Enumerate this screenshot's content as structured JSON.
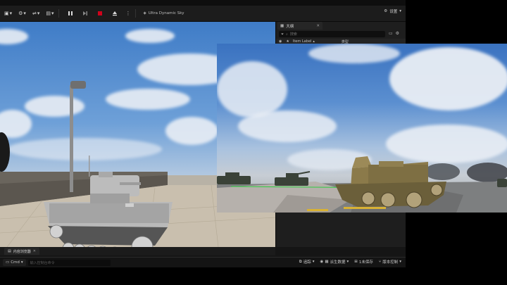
{
  "toolbar": {
    "play_label": "",
    "level_name": "Ultra Dynamic Sky",
    "settings_label": "设置"
  },
  "outliner": {
    "tab_label": "大纲",
    "search_placeholder": "搜索",
    "col_item_label": "Item Label",
    "col_type": "类型"
  },
  "bottom_tab": {
    "label": "内容浏览器"
  },
  "statusbar": {
    "cmd_label": "Cmd",
    "cmd_placeholder": "输入控制台命令",
    "trace_label": "追踪",
    "derived_data_label": "派生数据",
    "unsaved_label": "1未保存",
    "source_control_label": "版本控制"
  },
  "colors": {
    "accent": "#2b6fd6",
    "stop_red": "#d0021b",
    "panel": "#1e1e1e"
  }
}
